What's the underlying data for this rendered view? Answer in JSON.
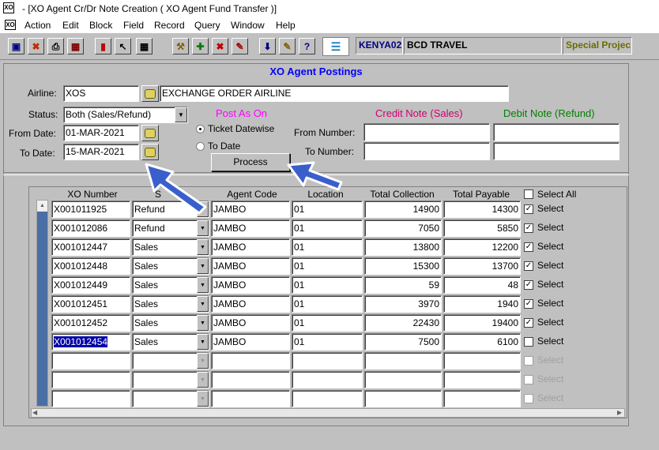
{
  "window": {
    "title": "- [XO Agent Cr/Dr Note Creation  ( XO Agent Fund Transfer )]"
  },
  "menu": [
    "Action",
    "Edit",
    "Block",
    "Field",
    "Record",
    "Query",
    "Window",
    "Help"
  ],
  "toolbar": {
    "user_code": "KENYA02",
    "agency_name": "BCD TRAVEL",
    "project_label": "Special Projec",
    "colors": {
      "special": "#6b6b00",
      "user": "#000080"
    }
  },
  "form": {
    "header": "XO Agent Postings",
    "airline_label": "Airline:",
    "airline_code": "XOS",
    "airline_name": "EXCHANGE ORDER AIRLINE",
    "status_label": "Status:",
    "status_value": "Both (Sales/Refund)",
    "from_date_label": "From Date:",
    "from_date": "01-MAR-2021",
    "to_date_label": "To Date:",
    "to_date": "15-MAR-2021",
    "post_as_on_label": "Post As On",
    "radio_ticket": "Ticket Datewise",
    "radio_todate": "To Date",
    "process_label": "Process",
    "credit_note_label": "Credit Note (Sales)",
    "debit_note_label": "Debit Note (Refund)",
    "from_number_label": "From Number:",
    "to_number_label": "To Number:",
    "colors": {
      "header": "#0000ff",
      "post_as_on": "#ff00ff",
      "credit": "#d00070",
      "debit": "#008000"
    }
  },
  "grid": {
    "headers": {
      "xo_number": "XO Number",
      "type": "S",
      "agent_code": "Agent Code",
      "location": "Location",
      "total_collection": "Total Collection",
      "total_payable": "Total Payable",
      "select_all": "Select All"
    },
    "select_label": "Select",
    "rows": [
      {
        "xo": "X001011925",
        "type": "Refund",
        "agent": "JAMBO",
        "loc": "01",
        "collection": "14900",
        "payable": "14300",
        "checked": true
      },
      {
        "xo": "X001012086",
        "type": "Refund",
        "agent": "JAMBO",
        "loc": "01",
        "collection": "7050",
        "payable": "5850",
        "checked": true
      },
      {
        "xo": "X001012447",
        "type": "Sales",
        "agent": "JAMBO",
        "loc": "01",
        "collection": "13800",
        "payable": "12200",
        "checked": true
      },
      {
        "xo": "X001012448",
        "type": "Sales",
        "agent": "JAMBO",
        "loc": "01",
        "collection": "15300",
        "payable": "13700",
        "checked": true
      },
      {
        "xo": "X001012449",
        "type": "Sales",
        "agent": "JAMBO",
        "loc": "01",
        "collection": "59",
        "payable": "48",
        "checked": true
      },
      {
        "xo": "X001012451",
        "type": "Sales",
        "agent": "JAMBO",
        "loc": "01",
        "collection": "3970",
        "payable": "1940",
        "checked": true
      },
      {
        "xo": "X001012452",
        "type": "Sales",
        "agent": "JAMBO",
        "loc": "01",
        "collection": "22430",
        "payable": "19400",
        "checked": true
      },
      {
        "xo": "X001012454",
        "type": "Sales",
        "agent": "JAMBO",
        "loc": "01",
        "collection": "7500",
        "payable": "6100",
        "checked": false
      },
      {
        "xo": "",
        "type": "",
        "agent": "",
        "loc": "",
        "collection": "",
        "payable": "",
        "checked": false,
        "empty": true
      },
      {
        "xo": "",
        "type": "",
        "agent": "",
        "loc": "",
        "collection": "",
        "payable": "",
        "checked": false,
        "empty": true
      },
      {
        "xo": "",
        "type": "",
        "agent": "",
        "loc": "",
        "collection": "",
        "payable": "",
        "checked": false,
        "empty": true
      }
    ]
  },
  "annotation_color": "#3a5fcd"
}
